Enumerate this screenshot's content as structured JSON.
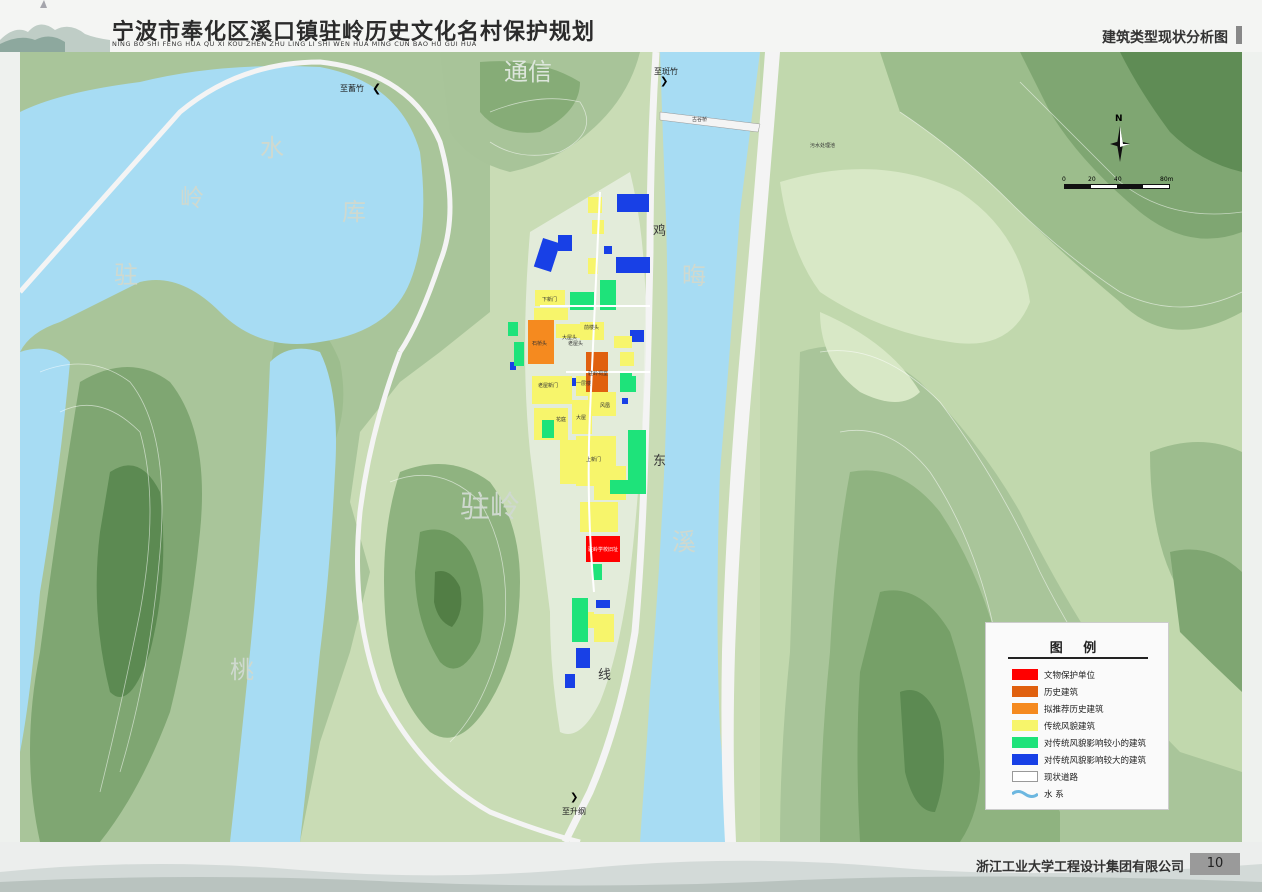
{
  "header": {
    "title": "宁波市奉化区溪口镇驻岭历史文化名村保护规划",
    "pinyin": "NING BO SHI FENG HUA QU XI KOU ZHEN ZHU LING LI SHI WEN HUA MING CUN BAO HU GUI HUA",
    "subtitle": "建筑类型现状分析图"
  },
  "map": {
    "places": {
      "reservoir_1": "水",
      "reservoir_2": "岭",
      "reservoir_3": "库",
      "reservoir_4": "驻",
      "tongxin": "通信",
      "hui": "晦",
      "xi": "溪",
      "zhuling": "驻岭",
      "tao": "桃",
      "ji": "鸡",
      "dong": "东",
      "xian": "线"
    },
    "directions": {
      "north_left": "至蓄竹",
      "north_right": "至斑竹",
      "south": "至升纲"
    },
    "bridge_label": "古谷桥",
    "facility_label": "污水处理池",
    "building_labels": {
      "b1": "下新门",
      "b2": "石桥头",
      "b3": "大屋头",
      "b4": "前楼头",
      "b5": "老屋头",
      "b6": "驻岭祠堂",
      "b7": "老屋新门",
      "b8": "一层楼",
      "b9": "风凰",
      "b10": "花庭",
      "b11": "大屋",
      "b12": "上新门",
      "b13": "驻岭学校旧址"
    },
    "north_arrow": "N",
    "scale": {
      "ticks": [
        "0",
        "20",
        "40",
        "80m"
      ]
    }
  },
  "legend": {
    "title": "图 例",
    "items": [
      {
        "label": "文物保护单位",
        "color": "#ff0000"
      },
      {
        "label": "历史建筑",
        "color": "#e0600e"
      },
      {
        "label": "拟推荐历史建筑",
        "color": "#f58a1f"
      },
      {
        "label": "传统风貌建筑",
        "color": "#f7f56b"
      },
      {
        "label": "对传统风貌影响较小的建筑",
        "color": "#1ee37a"
      },
      {
        "label": "对传统风貌影响较大的建筑",
        "color": "#1840e6"
      },
      {
        "label": "现状道路",
        "color": "#ffffff"
      },
      {
        "label": "水  系",
        "color": "#9fd8f0"
      }
    ]
  },
  "footer": {
    "company": "浙江工业大学工程设计集团有限公司",
    "page": "10"
  }
}
